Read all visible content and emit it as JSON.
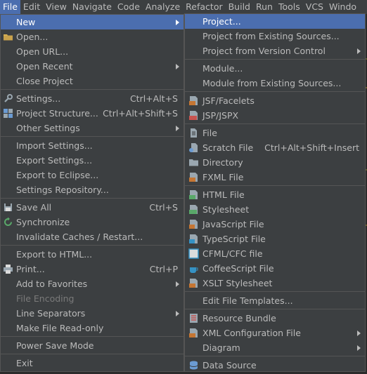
{
  "menubar": {
    "items": [
      "File",
      "Edit",
      "View",
      "Navigate",
      "Code",
      "Analyze",
      "Refactor",
      "Build",
      "Run",
      "Tools",
      "VCS",
      "Windo"
    ]
  },
  "file_menu": {
    "items": [
      {
        "label": "New",
        "submenu": true,
        "selected": true
      },
      {
        "label": "Open...",
        "icon": "folder-icon"
      },
      {
        "label": "Open URL..."
      },
      {
        "label": "Open Recent",
        "submenu": true
      },
      {
        "label": "Close Project"
      },
      {
        "label": "Settings...",
        "shortcut": "Ctrl+Alt+S",
        "icon": "wrench-icon"
      },
      {
        "label": "Project Structure...",
        "shortcut": "Ctrl+Alt+Shift+S",
        "icon": "project-structure-icon"
      },
      {
        "label": "Other Settings",
        "submenu": true
      },
      {
        "label": "Import Settings..."
      },
      {
        "label": "Export Settings..."
      },
      {
        "label": "Export to Eclipse..."
      },
      {
        "label": "Settings Repository..."
      },
      {
        "label": "Save All",
        "shortcut": "Ctrl+S",
        "icon": "save-icon"
      },
      {
        "label": "Synchronize",
        "icon": "sync-icon"
      },
      {
        "label": "Invalidate Caches / Restart..."
      },
      {
        "label": "Export to HTML..."
      },
      {
        "label": "Print...",
        "shortcut": "Ctrl+P",
        "icon": "print-icon"
      },
      {
        "label": "Add to Favorites",
        "submenu": true
      },
      {
        "label": "File Encoding",
        "disabled": true
      },
      {
        "label": "Line Separators",
        "submenu": true
      },
      {
        "label": "Make File Read-only"
      },
      {
        "label": "Power Save Mode"
      },
      {
        "label": "Exit"
      }
    ]
  },
  "new_menu": {
    "items": [
      {
        "label": "Project...",
        "selected": true
      },
      {
        "label": "Project from Existing Sources..."
      },
      {
        "label": "Project from Version Control",
        "submenu": true
      },
      {
        "label": "Module..."
      },
      {
        "label": "Module from Existing Sources..."
      },
      {
        "label": "JSF/Facelets",
        "icon": "jsf-icon"
      },
      {
        "label": "JSP/JSPX",
        "icon": "jsp-icon"
      },
      {
        "label": "File",
        "icon": "file-icon"
      },
      {
        "label": "Scratch File",
        "shortcut": "Ctrl+Alt+Shift+Insert",
        "icon": "scratch-file-icon"
      },
      {
        "label": "Directory",
        "icon": "directory-icon"
      },
      {
        "label": "FXML File",
        "icon": "fxml-icon"
      },
      {
        "label": "HTML File",
        "icon": "html-icon"
      },
      {
        "label": "Stylesheet",
        "icon": "css-icon"
      },
      {
        "label": "JavaScript File",
        "icon": "javascript-icon"
      },
      {
        "label": "TypeScript File",
        "icon": "typescript-icon"
      },
      {
        "label": "CFML/CFC file",
        "icon": "cfml-icon"
      },
      {
        "label": "CoffeeScript File",
        "icon": "coffeescript-icon"
      },
      {
        "label": "XSLT Stylesheet",
        "icon": "xslt-icon"
      },
      {
        "label": "Edit File Templates..."
      },
      {
        "label": "Resource Bundle",
        "icon": "resource-bundle-icon"
      },
      {
        "label": "XML Configuration File",
        "submenu": true,
        "icon": "xml-config-icon"
      },
      {
        "label": "Diagram",
        "submenu": true
      },
      {
        "label": "Data Source",
        "icon": "data-source-icon"
      }
    ]
  },
  "colors": {
    "menu_bg": "#3c3f41",
    "selection": "#4b6eaf",
    "separator": "#555555",
    "text": "#bbbbbb"
  }
}
